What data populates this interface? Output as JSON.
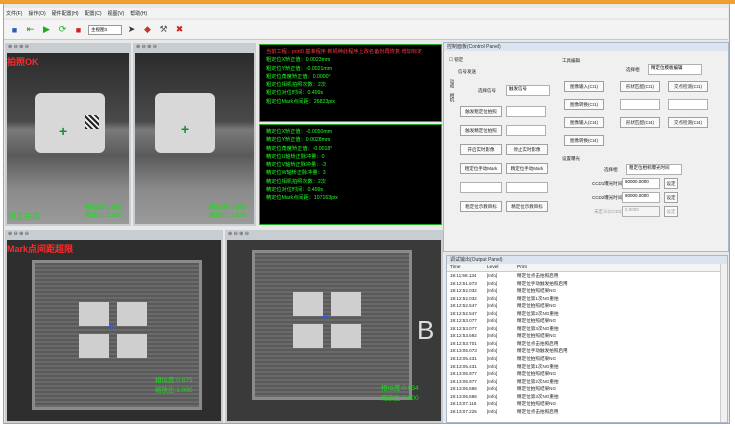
{
  "menu": [
    "文件(F)",
    "操作(O)",
    "硬件配置(H)",
    "配置(C)",
    "视图(V)",
    "帮助(H)"
  ],
  "toolbar": {
    "select_value": "主视图3"
  },
  "panes": {
    "tl": {
      "status": "拍照OK",
      "status2": "矫正完成",
      "coord1": "相似度:0.953",
      "coord2": "缩放比:1.000"
    },
    "tr": {
      "coord1": "相似度:0.895",
      "coord2": "缩放比:1.000"
    },
    "bl": {
      "status": "Mark点间距超限",
      "coord1": "相似度:0.875",
      "coord2": "缩放比:1.000"
    },
    "br": {
      "coord1": "相似度:0.934",
      "coord2": "缩放比:1.000"
    }
  },
  "info_top": {
    "header": "当前工程：port0 基准程序 新机种此程序上改名备份再恢复 增加标定",
    "lines": [
      "粗定位X矫正值：0.0023mm",
      "粗定位Y矫正值：-0.0021mm",
      "粗定位角度矫正值：0.0000°",
      "粗定位相机拍照次数：2次",
      "粗定位对位时间：0.499s",
      "粗定位Mark点间距：26823pix"
    ]
  },
  "info_bottom": {
    "lines": [
      "精定位X矫正值：-0.0050mm",
      "精定位Y矫正值：0.0028mm",
      "精定位角度矫正值：-0.0018°",
      "精定位U轴矫正脉冲量：0",
      "精定位V轴矫正脉冲量：-3",
      "精定位W轴矫正脉冲量：3",
      "精定位相机拍照次数：2次",
      "精定位对位时间：0.499s",
      "精定位Mark点间距：107163pix"
    ]
  },
  "control": {
    "title": "控制面板(Control Panel)",
    "lock_label": "锁定",
    "tabs": [
      "运动",
      "相机",
      "设定"
    ],
    "signal_section": "信号发送",
    "select_signal_label": "选择信号",
    "select_signal_value": "触发信号",
    "buttons_left": [
      "触发粗定位拍照",
      "触发精定位拍照",
      "开启实时影像",
      "粗定位手动Mark",
      "粗定位示教目标"
    ],
    "buttons_mid": [
      "停止实时影像",
      "精定位手动Mark",
      "精定位示教目标"
    ],
    "tool_section": "工具编辑",
    "tool_select_label": "选择相",
    "tool_select_value": "精定位模板编辑",
    "tool_buttons": [
      "图像输入(CI1)",
      "形状匹配(CI1)",
      "交点检测(CI1)",
      "图像转换(CI1)",
      "图像输入(CI4)",
      "形状匹配(CI4)",
      "交点检测(CI4)",
      "图像转换(CI4)"
    ],
    "exposure_section": "设置曝光",
    "exposure_select_label": "选择相",
    "exposure_select_value": "粗定位相机曝光时间",
    "ccd1_label": "CCD1曝光时间",
    "ccd1_value": "50000.0000",
    "ccd2_label": "CCD2曝光时间",
    "ccd2_value": "50000.0000",
    "ccd3_label": "未定义(CCD3)",
    "ccd3_value": "0.0000",
    "set_label": "设定"
  },
  "output": {
    "title": "调试输出(Output Panel)",
    "headers": [
      "Time",
      "Level",
      "Print"
    ],
    "rows": [
      [
        "19:11:58.134",
        "[Info]",
        "精定位点击拍照启用"
      ],
      [
        "19:12:51.673",
        "[Info]",
        "精定位手动触发拍照启用"
      ],
      [
        "19:12:52.032",
        "[Info]",
        "精定位拍照结果NG"
      ],
      [
        "19:12:52.032",
        "[Info]",
        "精定位第1次NG重拍"
      ],
      [
        "19:12:52.547",
        "[Info]",
        "精定位拍照结果NG"
      ],
      [
        "19:12:52.547",
        "[Info]",
        "精定位第2次NG重拍"
      ],
      [
        "19:12:53.077",
        "[Info]",
        "精定位拍照结果NG"
      ],
      [
        "19:12:53.077",
        "[Info]",
        "精定位第3次NG重拍"
      ],
      [
        "19:12:53.592",
        "[Info]",
        "精定位拍照结果NG"
      ],
      [
        "19:12:53.701",
        "[Info]",
        "精定位点击拍照启用"
      ],
      [
        "19:13:05.073",
        "[Info]",
        "精定位手动触发拍照启用"
      ],
      [
        "19:13:05.431",
        "[Info]",
        "精定位拍照结果NG"
      ],
      [
        "19:13:05.431",
        "[Info]",
        "精定位第1次NG重拍"
      ],
      [
        "19:13:05.977",
        "[Info]",
        "精定位拍照结果NG"
      ],
      [
        "19:13:05.977",
        "[Info]",
        "精定位第2次NG重拍"
      ],
      [
        "19:13:06.586",
        "[Info]",
        "精定位拍照结果NG"
      ],
      [
        "19:13:06.586",
        "[Info]",
        "精定位第3次NG重拍"
      ],
      [
        "19:13:07.116",
        "[Info]",
        "精定位拍照结果NG"
      ],
      [
        "19:13:07.225",
        "[Info]",
        "精定位点击拍照启用"
      ]
    ]
  }
}
